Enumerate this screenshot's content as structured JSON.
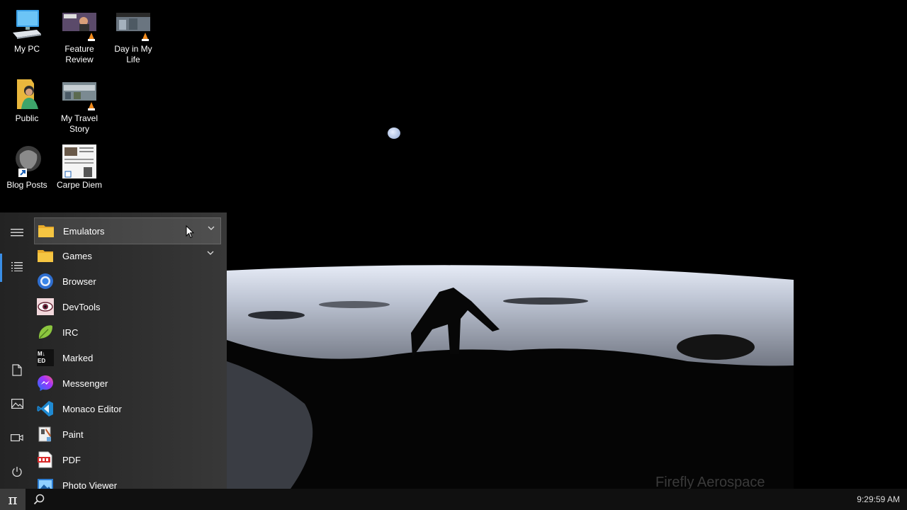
{
  "desktop": {
    "icons": [
      {
        "label": "My PC",
        "icon": "computer-icon"
      },
      {
        "label": "Feature Review",
        "icon": "video-thumbnail-icon"
      },
      {
        "label": "Day in My Life",
        "icon": "video-thumbnail-icon"
      },
      {
        "label": "Public",
        "icon": "folder-icon"
      },
      {
        "label": "My Travel Story",
        "icon": "video-thumbnail-icon"
      },
      {
        "label": "Blog Posts",
        "icon": "shortcut-icon"
      },
      {
        "label": "Carpe Diem",
        "icon": "document-thumbnail-icon"
      }
    ],
    "watermark": "Firefly Aerospace"
  },
  "start_menu": {
    "rail": [
      {
        "name": "menu",
        "icon": "hamburger-icon"
      },
      {
        "name": "all-apps",
        "icon": "list-icon"
      },
      {
        "name": "documents",
        "icon": "document-icon"
      },
      {
        "name": "pictures",
        "icon": "image-icon"
      },
      {
        "name": "videos",
        "icon": "video-camera-icon"
      },
      {
        "name": "power",
        "icon": "power-icon"
      }
    ],
    "apps": [
      {
        "label": "Emulators",
        "icon": "folder-icon",
        "expandable": true
      },
      {
        "label": "Games",
        "icon": "folder-icon",
        "expandable": true
      },
      {
        "label": "Browser",
        "icon": "browser-icon"
      },
      {
        "label": "DevTools",
        "icon": "devtools-icon"
      },
      {
        "label": "IRC",
        "icon": "irc-icon"
      },
      {
        "label": "Marked",
        "icon": "marked-icon"
      },
      {
        "label": "Messenger",
        "icon": "messenger-icon"
      },
      {
        "label": "Monaco Editor",
        "icon": "vscode-icon"
      },
      {
        "label": "Paint",
        "icon": "paint-icon"
      },
      {
        "label": "PDF",
        "icon": "pdf-icon"
      },
      {
        "label": "Photo Viewer",
        "icon": "photo-viewer-icon"
      }
    ],
    "marked_icon_text": "M↓ ED"
  },
  "taskbar": {
    "start_glyph": "π",
    "clock": "9:29:59 AM"
  },
  "colors": {
    "accent": "#3a8ee6",
    "folder": "#f5c542",
    "taskbar": "#101010"
  }
}
